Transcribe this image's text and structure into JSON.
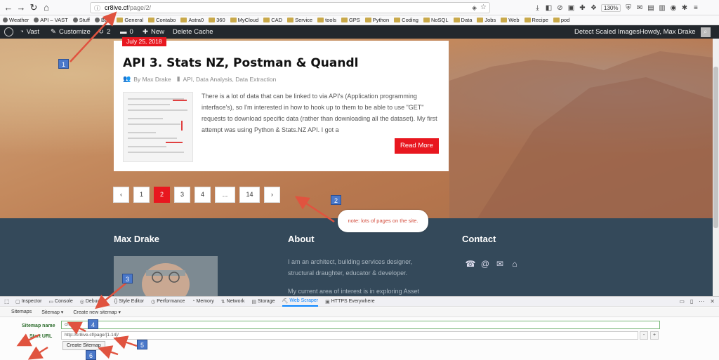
{
  "browser": {
    "url_host": "cr8ive.cf",
    "url_path": "/page/2/",
    "zoom": "130%"
  },
  "bookmarks": [
    {
      "label": "Weather",
      "kind": "site"
    },
    {
      "label": "API – VAST",
      "kind": "site"
    },
    {
      "label": "Stuff",
      "kind": "site"
    },
    {
      "label": "BBC",
      "kind": "site"
    },
    {
      "label": "General",
      "kind": "folder"
    },
    {
      "label": "Contabo",
      "kind": "folder"
    },
    {
      "label": "Astra0",
      "kind": "folder"
    },
    {
      "label": "360",
      "kind": "folder"
    },
    {
      "label": "MyCloud",
      "kind": "folder"
    },
    {
      "label": "CAD",
      "kind": "folder"
    },
    {
      "label": "Service",
      "kind": "folder"
    },
    {
      "label": "tools",
      "kind": "folder"
    },
    {
      "label": "GPS",
      "kind": "folder"
    },
    {
      "label": "Python",
      "kind": "folder"
    },
    {
      "label": "Coding",
      "kind": "folder"
    },
    {
      "label": "NoSQL",
      "kind": "folder"
    },
    {
      "label": "Data",
      "kind": "folder"
    },
    {
      "label": "Jobs",
      "kind": "folder"
    },
    {
      "label": "Web",
      "kind": "folder"
    },
    {
      "label": "Recipe",
      "kind": "folder"
    },
    {
      "label": "pod",
      "kind": "folder"
    }
  ],
  "adminbar": {
    "site_name": "Vast",
    "customize": "Customize",
    "updates_count": "2",
    "comments_count": "0",
    "new_label": "New",
    "delete_cache": "Delete Cache",
    "detect_scaled": "Detect Scaled Images",
    "howdy": "Howdy, Max Drake"
  },
  "post": {
    "date": "July 25, 2018",
    "title": "API 3. Stats NZ, Postman & Quandl",
    "author": "By Max Drake",
    "categories": "API, Data Analysis, Data Extraction",
    "excerpt": "There is a lot of data that can be linked to via API's (Application programming interface's), so I'm interested in how to hook up to them to be able to use \"GET\" requests to download specific data (rather than downloading all the dataset). My first attempt was using Python & Stats.NZ API. I got a",
    "read_more": "Read More"
  },
  "pagination": {
    "prev": "‹",
    "pages": [
      "1",
      "2",
      "3",
      "4",
      "...",
      "14"
    ],
    "active": "2",
    "next": "›"
  },
  "footer": {
    "col1_title": "Max Drake",
    "col2_title": "About",
    "col2_text_1": "I am an architect, building services designer, structural draughter, educator & developer.",
    "col2_text_2": "My current area of interest is in exploring  Asset",
    "col3_title": "Contact"
  },
  "devtools": {
    "tabs": [
      "Inspector",
      "Console",
      "Debugger",
      "Style Editor",
      "Performance",
      "Memory",
      "Network",
      "Storage",
      "Web Scraper",
      "HTTPS Everywhere"
    ],
    "active_tab": "Web Scraper",
    "scraper_nav": [
      "Sitemaps",
      "Sitemap ▾",
      "Create new sitemap ▾"
    ],
    "sitemap_name_label": "Sitemap name",
    "sitemap_name_value": "cr8ive",
    "start_url_label": "Start URL",
    "start_url_value": "http://cr8ive.cf/page/[1-14]/",
    "create_button": "Create Sitemap"
  },
  "annotations": {
    "markers": [
      "1",
      "2",
      "3",
      "4",
      "5",
      "6"
    ],
    "note": "note: lots of pages on the site.",
    "arrow_color": "#e0533f",
    "marker_color": "#4a78c9"
  },
  "colors": {
    "accent_red": "#e8171f",
    "footer_bg": "#34495a",
    "adminbar_bg": "#23282d"
  }
}
